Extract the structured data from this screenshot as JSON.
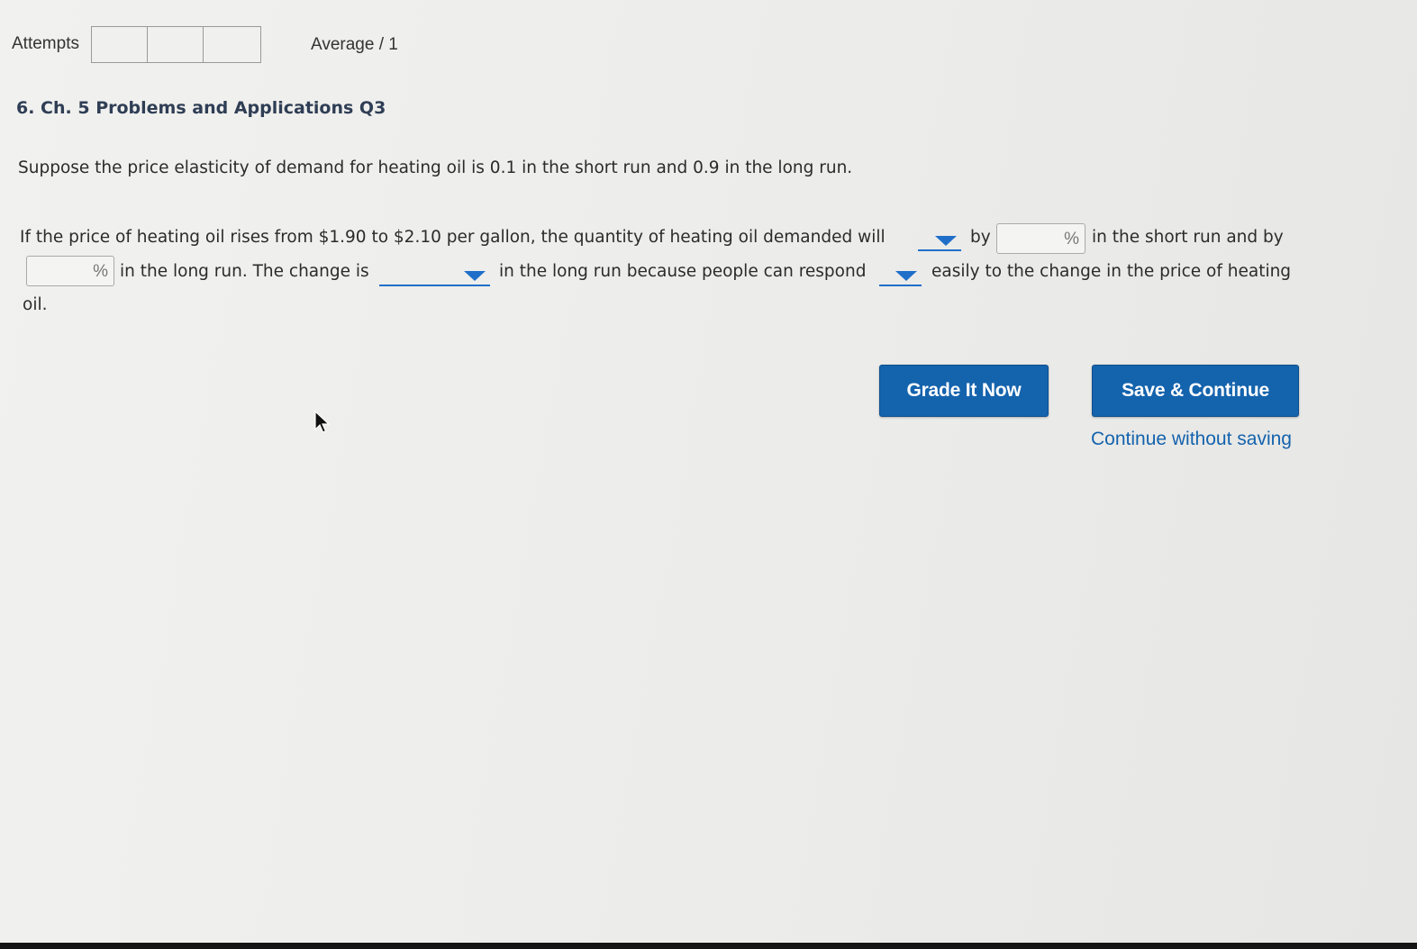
{
  "attempts": {
    "label": "Attempts",
    "boxes": [
      "",
      "",
      ""
    ]
  },
  "average": {
    "label": "Average / 1"
  },
  "question": {
    "title": "6. Ch. 5 Problems and Applications Q3",
    "prompt": "Suppose the price elasticity of demand for heating oil is 0.1 in the short run and 0.9 in the long run.",
    "seg1": "If the price of heating oil rises from $1.90 to $2.10 per gallon, the quantity of heating oil demanded will",
    "seg2": "by",
    "seg3": "in the short run and by",
    "seg4": "in the long run. The change is",
    "seg5": "in the long run because people can respond",
    "seg6": "easily to the change in the price of heating",
    "seg7": "oil.",
    "dropdown_direction": "",
    "input_short_run": {
      "value": "",
      "unit": "%"
    },
    "input_long_run": {
      "value": "",
      "unit": "%"
    },
    "dropdown_change": "",
    "dropdown_respond": ""
  },
  "actions": {
    "grade_label": "Grade It Now",
    "save_label": "Save & Continue",
    "continue_link": "Continue without saving"
  },
  "colors": {
    "accent": "#1463ad",
    "title": "#2f3e55"
  },
  "icons": {
    "caret": "caret-down-icon",
    "cursor": "mouse-pointer-icon"
  }
}
